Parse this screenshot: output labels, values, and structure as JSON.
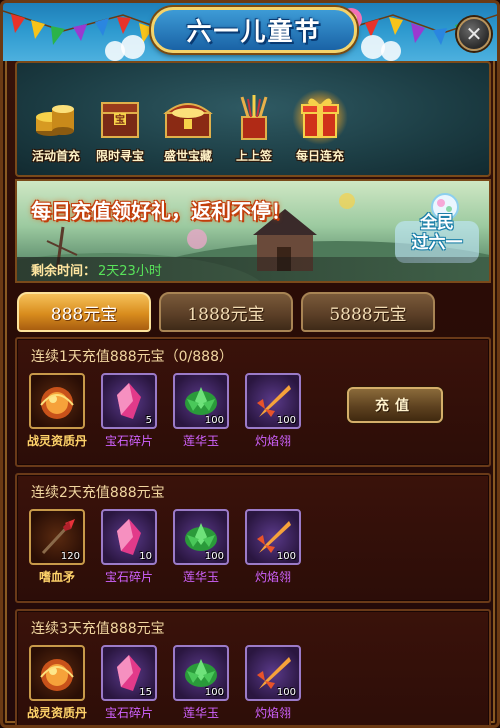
{
  "window": {
    "title": "六一儿童节",
    "close_label": "✕"
  },
  "activities": [
    {
      "label": "活动首充",
      "icon": "gold-coins-icon",
      "active": false
    },
    {
      "label": "限时寻宝",
      "icon": "treasure-box-icon",
      "active": false
    },
    {
      "label": "盛世宝藏",
      "icon": "treasure-chest-icon",
      "active": false
    },
    {
      "label": "上上签",
      "icon": "fortune-sticks-icon",
      "active": false
    },
    {
      "label": "每日连充",
      "icon": "gift-box-icon",
      "active": true
    }
  ],
  "promo": {
    "title": "每日充值领好礼，返利不停！",
    "badge_line1": "全民",
    "badge_line2": "过六一",
    "countdown_label": "剩余时间：",
    "countdown_value": "2天23小时"
  },
  "tabs": [
    {
      "label": "888元宝",
      "active": true
    },
    {
      "label": "1888元宝",
      "active": false
    },
    {
      "label": "5888元宝",
      "active": false
    }
  ],
  "panels": [
    {
      "title": "连续1天充值888元宝（0/888）",
      "button_label": "充值",
      "rewards": [
        {
          "name": "战灵资质丹",
          "count": "",
          "icon": "spirit-pill-icon",
          "color": "orange"
        },
        {
          "name": "宝石碎片",
          "count": "5",
          "icon": "gem-shard-icon",
          "color": "purple"
        },
        {
          "name": "莲华玉",
          "count": "100",
          "icon": "lotus-jade-icon",
          "color": "purple"
        },
        {
          "name": "灼焰翎",
          "count": "100",
          "icon": "flame-feather-icon",
          "color": "purple"
        }
      ]
    },
    {
      "title": "连续2天充值888元宝",
      "rewards": [
        {
          "name": "嗜血矛",
          "count": "120",
          "icon": "bloodthirst-spear-icon",
          "color": "orange"
        },
        {
          "name": "宝石碎片",
          "count": "10",
          "icon": "gem-shard-icon",
          "color": "purple"
        },
        {
          "name": "莲华玉",
          "count": "100",
          "icon": "lotus-jade-icon",
          "color": "purple"
        },
        {
          "name": "灼焰翎",
          "count": "100",
          "icon": "flame-feather-icon",
          "color": "purple"
        }
      ]
    },
    {
      "title": "连续3天充值888元宝",
      "rewards": [
        {
          "name": "战灵资质丹",
          "count": "",
          "icon": "spirit-pill-icon",
          "color": "orange"
        },
        {
          "name": "宝石碎片",
          "count": "15",
          "icon": "gem-shard-icon",
          "color": "purple"
        },
        {
          "name": "莲华玉",
          "count": "100",
          "icon": "lotus-jade-icon",
          "color": "purple"
        },
        {
          "name": "灼焰翎",
          "count": "100",
          "icon": "flame-feather-icon",
          "color": "purple"
        }
      ]
    }
  ]
}
